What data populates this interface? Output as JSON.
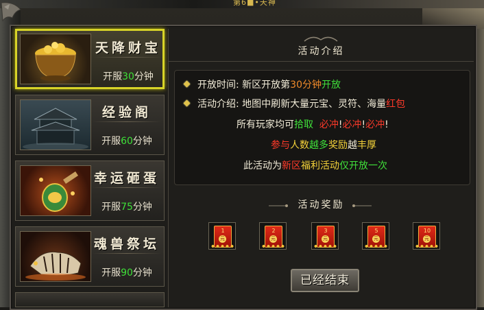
{
  "top_hint": "第6■•天神",
  "events": [
    {
      "title": "天降财宝",
      "time_prefix": "开服",
      "time_num": "30",
      "time_suffix": "分钟",
      "active": true,
      "icon": "treasure-pot-icon"
    },
    {
      "title": "经验阁",
      "time_prefix": "开服",
      "time_num": "60",
      "time_suffix": "分钟",
      "active": false,
      "icon": "pavilion-icon"
    },
    {
      "title": "幸运砸蛋",
      "time_prefix": "开服",
      "time_num": "75",
      "time_suffix": "分钟",
      "active": false,
      "icon": "golden-egg-icon"
    },
    {
      "title": "魂兽祭坛",
      "time_prefix": "开服",
      "time_num": "90",
      "time_suffix": "分钟",
      "active": false,
      "icon": "tiger-icon"
    }
  ],
  "intro": {
    "header": "活动介绍",
    "open_time_label": "开放时间:",
    "open_time_a": "新区开放第",
    "open_time_num": "30分钟",
    "open_time_b": "开放",
    "desc_label": "活动介绍:",
    "desc_a": "地图中刷新大量元宝、灵符、海量",
    "desc_red": "红包",
    "line3_a": "所有玩家均可",
    "line3_b": "拾取",
    "line3_c": "必冲",
    "line3_d": "!",
    "line3_e": "必冲",
    "line3_f": "!",
    "line3_g": "必冲",
    "line3_h": "!",
    "line4_a": "参与",
    "line4_b": "人数",
    "line4_c": "越多",
    "line4_d": "奖励",
    "line4_e": "越",
    "line4_f": "丰厚",
    "line5_a": "此活动为",
    "line5_b": "新区",
    "line5_c": "福利活动",
    "line5_d": "仅开放一次"
  },
  "rewards": {
    "header": "活动奖励",
    "items": [
      {
        "count": "1",
        "coin": "元"
      },
      {
        "count": "2",
        "coin": "元"
      },
      {
        "count": "3",
        "coin": "元"
      },
      {
        "count": "5",
        "coin": "元"
      },
      {
        "count": "10",
        "coin": "元"
      }
    ]
  },
  "end_button": "已经结束",
  "colors": {
    "active_border": "#d8d428",
    "green": "#40e03a",
    "red": "#ff3a2a",
    "yellow": "#f4d23a"
  }
}
